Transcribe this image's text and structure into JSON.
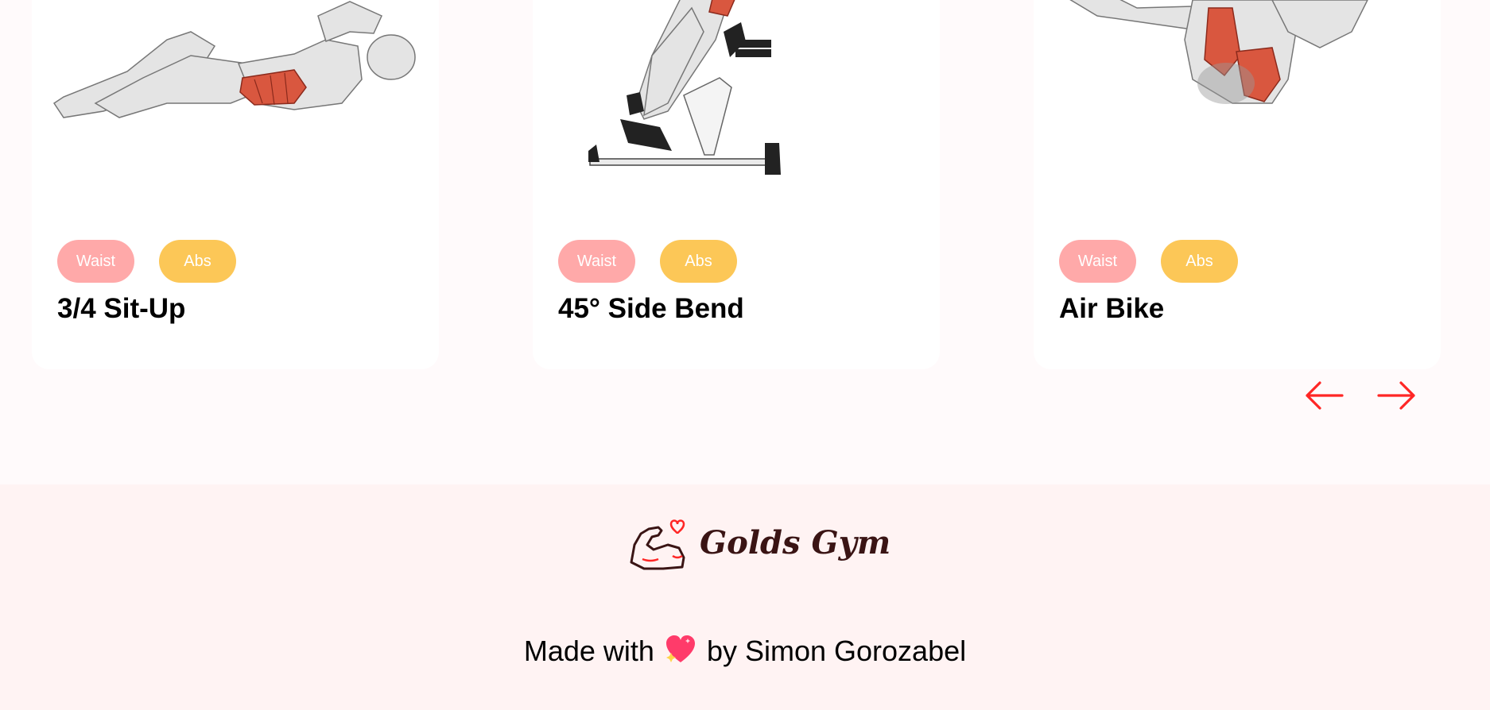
{
  "exercises": [
    {
      "title": "3/4 Sit-Up",
      "tags": [
        "Waist",
        "Abs"
      ],
      "image": "situp-illustration"
    },
    {
      "title": "45° Side Bend",
      "tags": [
        "Waist",
        "Abs"
      ],
      "image": "side-bend-illustration"
    },
    {
      "title": "Air Bike",
      "tags": [
        "Waist",
        "Abs"
      ],
      "image": "air-bike-illustration"
    }
  ],
  "carousel_nav": {
    "prev_icon": "arrow-left-icon",
    "next_icon": "arrow-right-icon"
  },
  "footer": {
    "brand": "Golds Gym",
    "credit_prefix": "Made with",
    "credit_suffix": "by Simon Gorozabel",
    "heart_icon": "sparkling-heart-icon"
  },
  "colors": {
    "page_bg": "#fffafb",
    "footer_bg": "#fff3f3",
    "tag_waist": "#ffa9a9",
    "tag_abs": "#fcc757",
    "arrow": "#ff2625",
    "brand_text": "#3a1414"
  }
}
